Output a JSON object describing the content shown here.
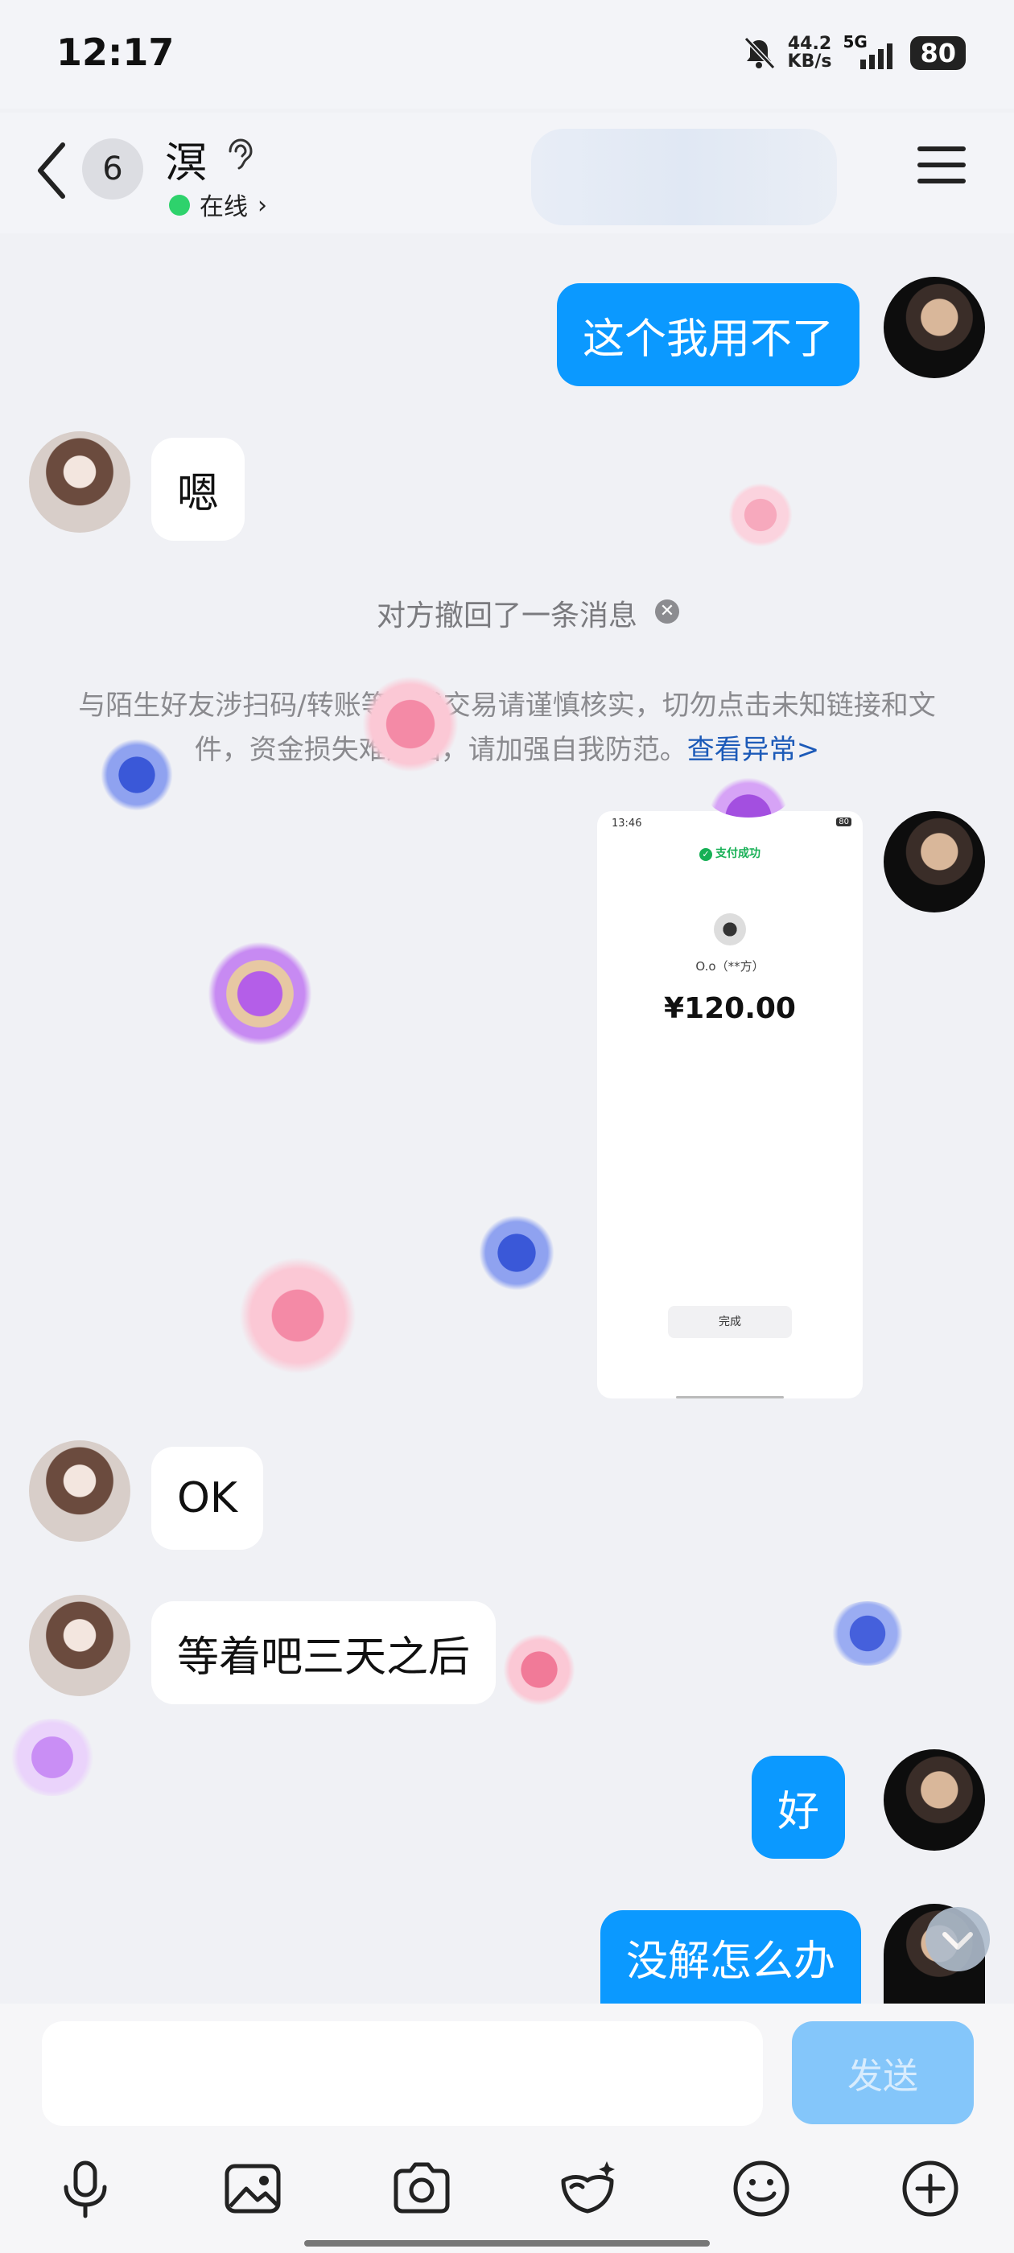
{
  "status_bar": {
    "time": "12:17",
    "net_speed_value": "44.2",
    "net_speed_unit": "KB/s",
    "network": "5G",
    "battery": "80"
  },
  "header": {
    "unread_count": "6",
    "contact_name": "溟",
    "status": "在线"
  },
  "messages": {
    "m1": "这个我用不了",
    "m2": "嗯",
    "recall_notice": "对方撤回了一条消息",
    "warning": "与陌生好友涉扫码/转账等金钱交易请谨慎核实，切勿点击未知链接和文件，资金损失难追回，请加强自我防范。",
    "warning_link": "查看异常>",
    "m3": "OK",
    "m4": "等着吧三天之后",
    "m5": "好",
    "m6": "没解怎么办"
  },
  "payment_screenshot": {
    "time": "13:46",
    "battery": "80",
    "status": "支付成功",
    "payee": "O.o（**方）",
    "amount": "¥120.00",
    "done_label": "完成"
  },
  "input_bar": {
    "send_label": "发送"
  },
  "colors": {
    "outgoing_bubble": "#0b99ff",
    "incoming_bubble": "#ffffff",
    "online": "#2ed26c",
    "link": "#1c5ab8"
  }
}
